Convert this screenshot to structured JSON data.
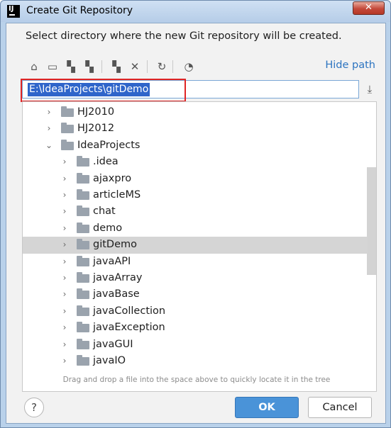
{
  "window": {
    "title": "Create Git Repository",
    "app_icon_text": "IJ",
    "close_symbol": "✕"
  },
  "dialog": {
    "description": "Select directory where the new Git repository will be created."
  },
  "toolbar": {
    "buttons": [
      {
        "name": "home-icon",
        "glyph": "⌂"
      },
      {
        "name": "desktop-icon",
        "glyph": "▭"
      },
      {
        "name": "project-folder-icon",
        "glyph": "▚"
      },
      {
        "name": "module-folder-icon",
        "glyph": "▚"
      },
      {
        "name": "new-folder-icon",
        "glyph": "▚"
      },
      {
        "name": "delete-icon",
        "glyph": "✕"
      },
      {
        "name": "refresh-icon",
        "glyph": "↻"
      },
      {
        "name": "show-hidden-icon",
        "glyph": "◔"
      }
    ],
    "hide_path_label": "Hide path"
  },
  "path_field": {
    "value": "E:\\IdeaProjects\\gitDemo"
  },
  "tree": {
    "items": [
      {
        "label": "HJ2010",
        "depth": 1,
        "expanded": false,
        "selected": false
      },
      {
        "label": "HJ2012",
        "depth": 1,
        "expanded": false,
        "selected": false
      },
      {
        "label": "IdeaProjects",
        "depth": 1,
        "expanded": true,
        "selected": false
      },
      {
        "label": ".idea",
        "depth": 2,
        "expanded": false,
        "selected": false
      },
      {
        "label": "ajaxpro",
        "depth": 2,
        "expanded": false,
        "selected": false
      },
      {
        "label": "articleMS",
        "depth": 2,
        "expanded": false,
        "selected": false
      },
      {
        "label": "chat",
        "depth": 2,
        "expanded": false,
        "selected": false
      },
      {
        "label": "demo",
        "depth": 2,
        "expanded": false,
        "selected": false
      },
      {
        "label": "gitDemo",
        "depth": 2,
        "expanded": false,
        "selected": true
      },
      {
        "label": "javaAPI",
        "depth": 2,
        "expanded": false,
        "selected": false
      },
      {
        "label": "javaArray",
        "depth": 2,
        "expanded": false,
        "selected": false
      },
      {
        "label": "javaBase",
        "depth": 2,
        "expanded": false,
        "selected": false
      },
      {
        "label": "javaCollection",
        "depth": 2,
        "expanded": false,
        "selected": false
      },
      {
        "label": "javaException",
        "depth": 2,
        "expanded": false,
        "selected": false
      },
      {
        "label": "javaGUI",
        "depth": 2,
        "expanded": false,
        "selected": false
      },
      {
        "label": "javaIO",
        "depth": 2,
        "expanded": false,
        "selected": false
      }
    ],
    "drag_hint": "Drag and drop a file into the space above to quickly locate it in the tree"
  },
  "buttons": {
    "help_label": "?",
    "ok_label": "OK",
    "cancel_label": "Cancel"
  },
  "colors": {
    "accent": "#4a93d8",
    "selection": "#2f65ca",
    "highlight_box": "#e02525",
    "link": "#2c74c0"
  }
}
